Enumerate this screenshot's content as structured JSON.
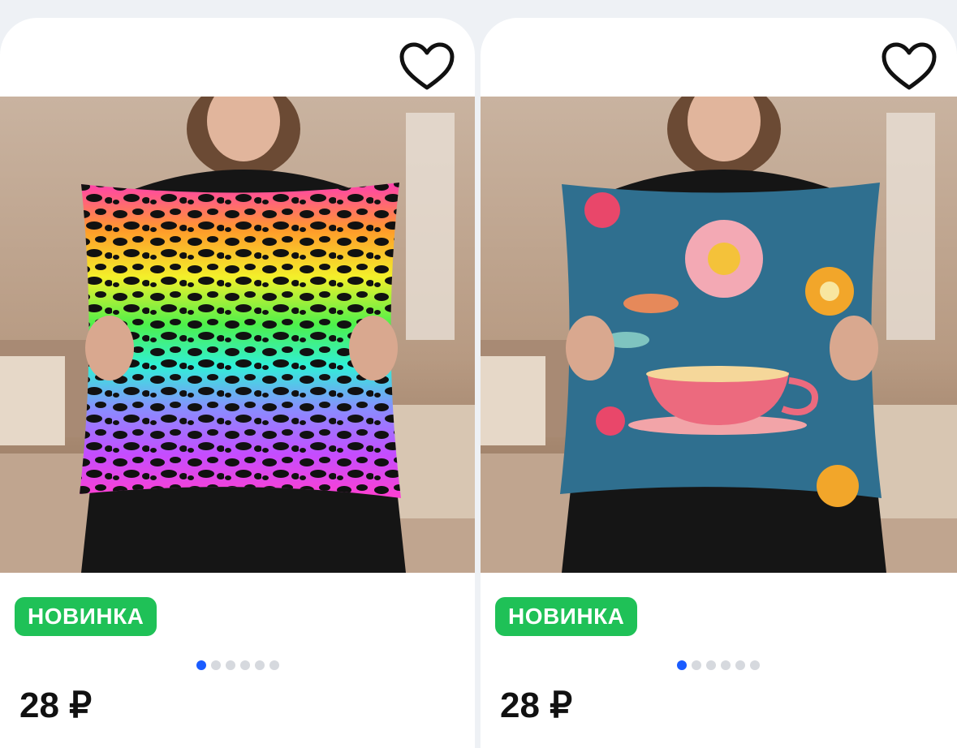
{
  "products": [
    {
      "badge": "НОВИНКА",
      "price": "28 ₽",
      "image_icon": "leopard-print-pillow",
      "favorite_icon": "heart-outline-icon",
      "carousel": {
        "count": 6,
        "active": 0
      }
    },
    {
      "badge": "НОВИНКА",
      "price": "28 ₽",
      "image_icon": "floral-teacup-pillow",
      "favorite_icon": "heart-outline-icon",
      "carousel": {
        "count": 6,
        "active": 0
      }
    }
  ],
  "colors": {
    "badge_bg": "#1fc157",
    "dot_active": "#1a5cff",
    "dot_inactive": "#d6d9de"
  }
}
